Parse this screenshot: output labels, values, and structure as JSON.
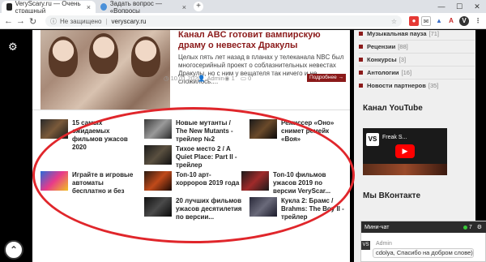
{
  "browser": {
    "tabs": [
      {
        "label": "VeryScary.ru — Очень страшный",
        "active": true
      },
      {
        "label": "Задать вопрос — «Вопросы",
        "active": false
      }
    ],
    "address": {
      "security": "Не защищено",
      "url": "veryscary.ru"
    }
  },
  "featured": {
    "title": "Канал ABC готовит вампирскую драму о невестах Дракулы",
    "excerpt": "Целых пять лет назад в планах у телеканала NBC был многосерийный проект о соблазнительных невестах Дракулы, но с ним у вещателя так ничего и не сложилось....",
    "date": "10.01.2020",
    "author": "Admin",
    "views": "1",
    "comments": "0",
    "more": "Подробнее →"
  },
  "related": [
    {
      "title": "15 самых ожидаемых фильмов ужасов 2020"
    },
    {
      "title": "Новые мутанты / The New Mutants - трейлер №2"
    },
    {
      "title": "Режиссер «Оно» снимет ремейк «Воя»"
    },
    {
      "title": "Тихое место 2 / A Quiet Place: Part II - трейлер"
    },
    {
      "title": "Играйте в игровые автоматы бесплатно и без"
    },
    {
      "title": "Топ-10 арт-хорроров 2019 года"
    },
    {
      "title": "Топ-10 фильмов ужасов 2019 по версии VeryScar..."
    },
    {
      "title": "20 лучших фильмов ужасов десятилетия по версии..."
    },
    {
      "title": "Кукла 2: Брамс / Brahms: The Boy II - трейлер"
    }
  ],
  "sidebar": {
    "categories": [
      {
        "label": "Музыкальная пауза",
        "count": "[71]"
      },
      {
        "label": "Рецензии",
        "count": "[88]"
      },
      {
        "label": "Конкурсы",
        "count": "[3]"
      },
      {
        "label": "Антологии",
        "count": "[16]"
      },
      {
        "label": "Новости партнеров",
        "count": "[35]"
      }
    ],
    "youtube_title": "Канал YouTube",
    "youtube_video": "Freak S...",
    "vk_title": "Мы ВКонтакте"
  },
  "chat": {
    "header": "Мини-чат",
    "online": "7",
    "author": "Admin",
    "message": "cdolya, Спасибо на добром слове)"
  },
  "colors": {
    "accent": "#8b1a1a",
    "annotation": "#e0262b"
  }
}
